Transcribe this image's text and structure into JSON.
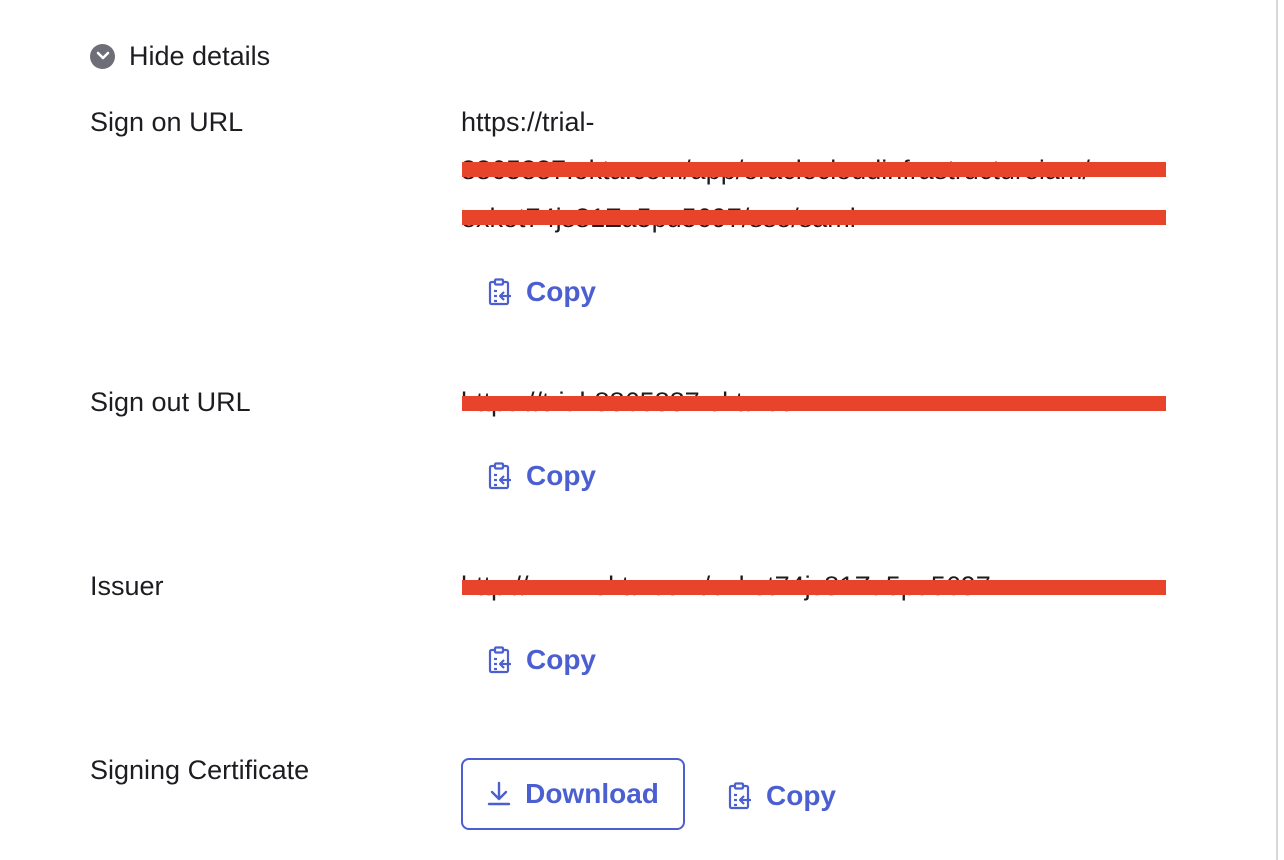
{
  "toggle": {
    "label": "Hide details",
    "icon": "chevron-down-circle-icon"
  },
  "sign_on": {
    "label": "Sign on URL",
    "url_lines": [
      "https://trial-",
      "8865887.okta.com/app/oraclecloudinfrastructureiam/",
      "exkot74js81Za5pu5697/sso/saml"
    ],
    "copy_label": "Copy"
  },
  "sign_out": {
    "label": "Sign out URL",
    "url_lines": [
      "https://trial-8865887.okta.com"
    ],
    "copy_label": "Copy"
  },
  "issuer": {
    "label": "Issuer",
    "url_lines": [
      "http://www.okta.com/exkot74js81Za5pu5697"
    ],
    "copy_label": "Copy"
  },
  "certificate": {
    "label": "Signing Certificate",
    "download_label": "Download",
    "copy_label": "Copy"
  },
  "colors": {
    "accent": "#4b5fd1",
    "redaction": "#e8432b",
    "text": "#1d1d21"
  }
}
